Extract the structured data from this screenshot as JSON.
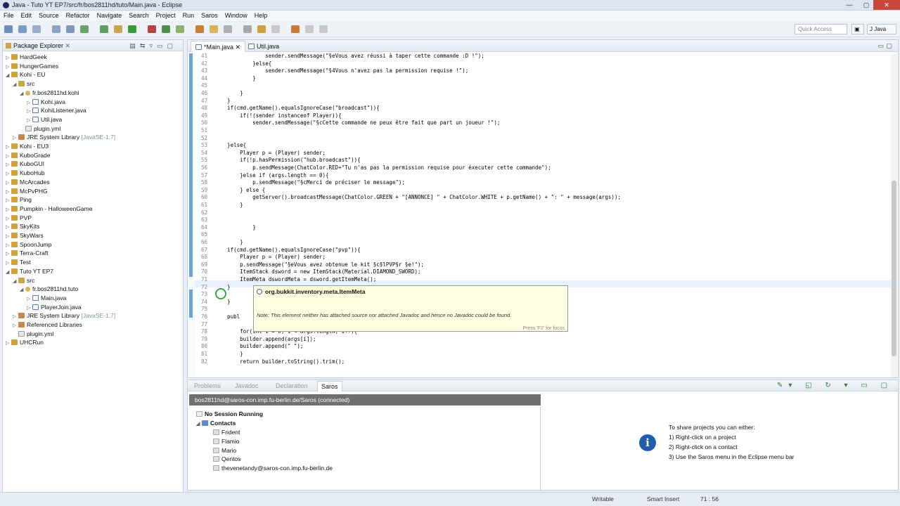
{
  "window": {
    "title": "Java - Tuto YT EP7/src/fr/bos2811hd/tuto/Main.java - Eclipse",
    "controls": [
      "—",
      "▢",
      "✕"
    ]
  },
  "menubar": [
    "File",
    "Edit",
    "Source",
    "Refactor",
    "Navigate",
    "Search",
    "Project",
    "Run",
    "Saros",
    "Window",
    "Help"
  ],
  "toolbar": {
    "quick_access": "Quick Access"
  },
  "package_explorer": {
    "title": "Package Explorer",
    "rows": [
      {
        "label": "HardGeek",
        "kind": "proj",
        "indent": 0,
        "tw": "▷"
      },
      {
        "label": "HungerGames",
        "kind": "proj",
        "indent": 0,
        "tw": "▷"
      },
      {
        "label": "Kohi - EU",
        "kind": "proj",
        "indent": 0,
        "tw": "◢"
      },
      {
        "label": "src",
        "kind": "src",
        "indent": 1,
        "tw": "◢"
      },
      {
        "label": "fr.bos2811hd.kohi",
        "kind": "pkg",
        "indent": 2,
        "tw": "◢"
      },
      {
        "label": "Kohi.java",
        "kind": "java",
        "indent": 3,
        "tw": "▷"
      },
      {
        "label": "KohiListener.java",
        "kind": "java",
        "indent": 3,
        "tw": "▷"
      },
      {
        "label": "Util.java",
        "kind": "java",
        "indent": 3,
        "tw": "▷"
      },
      {
        "label": "plugin.yml",
        "kind": "yml",
        "indent": 2,
        "tw": ""
      },
      {
        "label": "JRE System Library",
        "suffix": "[JavaSE-1.7]",
        "kind": "lib",
        "indent": 1,
        "tw": "▷"
      },
      {
        "label": "Kohi - EU3",
        "kind": "proj",
        "indent": 0,
        "tw": "▷"
      },
      {
        "label": "KuboGrade",
        "kind": "proj",
        "indent": 0,
        "tw": "▷"
      },
      {
        "label": "KuboGUI",
        "kind": "proj",
        "indent": 0,
        "tw": "▷"
      },
      {
        "label": "KuboHub",
        "kind": "proj",
        "indent": 0,
        "tw": "▷"
      },
      {
        "label": "McArcades",
        "kind": "proj",
        "indent": 0,
        "tw": "▷"
      },
      {
        "label": "McPvPHG",
        "kind": "proj",
        "indent": 0,
        "tw": "▷"
      },
      {
        "label": "Ping",
        "kind": "proj",
        "indent": 0,
        "tw": "▷"
      },
      {
        "label": "Pumpkin - HalloweenGame",
        "kind": "proj",
        "indent": 0,
        "tw": "▷"
      },
      {
        "label": "PVP",
        "kind": "proj",
        "indent": 0,
        "tw": "▷"
      },
      {
        "label": "SkyKits",
        "kind": "proj",
        "indent": 0,
        "tw": "▷"
      },
      {
        "label": "SkyWars",
        "kind": "proj",
        "indent": 0,
        "tw": "▷"
      },
      {
        "label": "SpoonJump",
        "kind": "proj",
        "indent": 0,
        "tw": "▷"
      },
      {
        "label": "Terra-Craft",
        "kind": "proj",
        "indent": 0,
        "tw": "▷"
      },
      {
        "label": "Test",
        "kind": "proj",
        "indent": 0,
        "tw": "▷"
      },
      {
        "label": "Tuto YT EP7",
        "kind": "proj",
        "indent": 0,
        "tw": "◢"
      },
      {
        "label": "src",
        "kind": "src",
        "indent": 1,
        "tw": "◢"
      },
      {
        "label": "fr.bos2811hd.tuto",
        "kind": "pkg",
        "indent": 2,
        "tw": "◢"
      },
      {
        "label": "Main.java",
        "kind": "java",
        "indent": 3,
        "tw": "▷"
      },
      {
        "label": "PlayerJoin.java",
        "kind": "java",
        "indent": 3,
        "tw": "▷"
      },
      {
        "label": "JRE System Library",
        "suffix": "[JavaSE-1.7]",
        "kind": "lib",
        "indent": 1,
        "tw": "▷"
      },
      {
        "label": "Referenced Libraries",
        "kind": "lib",
        "indent": 1,
        "tw": "▷"
      },
      {
        "label": "plugin.yml",
        "kind": "yml",
        "indent": 1,
        "tw": ""
      },
      {
        "label": "UHCRun",
        "kind": "proj",
        "indent": 0,
        "tw": "▷"
      }
    ]
  },
  "editor": {
    "tabs": [
      "*Main.java",
      "Util.java"
    ],
    "active_tab": 0,
    "lines": [
      {
        "n": "41",
        "t": "                sender.sendMessage(\"§eVous avez réussi à taper cette commande :D !\");"
      },
      {
        "n": "42",
        "t": "            }else{"
      },
      {
        "n": "43",
        "t": "                sender.sendMessage(\"§4Vous n'avez pas la permission requise !\");"
      },
      {
        "n": "44",
        "t": "            }"
      },
      {
        "n": "45",
        "t": ""
      },
      {
        "n": "46",
        "t": "        }"
      },
      {
        "n": "47",
        "t": "    }"
      },
      {
        "n": "48",
        "t": "    if(cmd.getName().equalsIgnoreCase(\"broadcast\")){"
      },
      {
        "n": "49",
        "t": "        if(!(sender instanceof Player)){"
      },
      {
        "n": "50",
        "t": "            sender.sendMessage(\"§cCette commande ne peux être fait que part un joueur !\");"
      },
      {
        "n": "51",
        "t": ""
      },
      {
        "n": "52",
        "t": ""
      },
      {
        "n": "53",
        "t": "    }else{"
      },
      {
        "n": "54",
        "t": "        Player p = (Player) sender;"
      },
      {
        "n": "55",
        "t": "        if(!p.hasPermission(\"hub.broadcast\")){"
      },
      {
        "n": "56",
        "t": "            p.sendMessage(ChatColor.RED+\"Tu n'as pas la permission requise pour éxecuter cette commande\");"
      },
      {
        "n": "57",
        "t": "        }else if (args.length == 0){"
      },
      {
        "n": "58",
        "t": "            p.sendMessage(\"§cMerci de préciser le message\");"
      },
      {
        "n": "59",
        "t": "        } else {"
      },
      {
        "n": "60",
        "t": "            getServer().broadcastMessage(ChatColor.GREEN + \"[ANNONCE] \" + ChatColor.WHITE + p.getName() + \": \" + message(args));"
      },
      {
        "n": "61",
        "t": "        }"
      },
      {
        "n": "62",
        "t": ""
      },
      {
        "n": "63",
        "t": ""
      },
      {
        "n": "64",
        "t": "            }"
      },
      {
        "n": "65",
        "t": ""
      },
      {
        "n": "66",
        "t": "        }"
      },
      {
        "n": "67",
        "t": "    if(cmd.getName().equalsIgnoreCase(\"pvp\")){"
      },
      {
        "n": "68",
        "t": "        Player p = (Player) sender;"
      },
      {
        "n": "69",
        "t": "        p.sendMessage(\"§eVous avez obtenue le kit §c§lPVP§r §e!\");"
      },
      {
        "n": "70",
        "t": "        ItemStack dsword = new ItemStack(Material.DIAMOND_SWORD);"
      },
      {
        "n": "71",
        "t": "        ItemMeta dswordMeta = dsword.getItemMeta();"
      },
      {
        "n": "72",
        "t": "    }"
      },
      {
        "n": "73",
        "t": ""
      },
      {
        "n": "74",
        "t": "    }"
      },
      {
        "n": "75",
        "t": ""
      },
      {
        "n": "76",
        "t": "    publ"
      },
      {
        "n": "77",
        "t": ""
      },
      {
        "n": "78",
        "t": "        for(int i = 0; i < args.length; i++){"
      },
      {
        "n": "79",
        "t": "        builder.append(args[i]);"
      },
      {
        "n": "80",
        "t": "        builder.append(\" \");"
      },
      {
        "n": "81",
        "t": "        }"
      },
      {
        "n": "82",
        "t": "        return builder.toString().trim();"
      }
    ],
    "tooltip": {
      "title": "org.bukkit.inventory.meta.ItemMeta",
      "note": "Note: This element neither has attached source nor attached Javadoc and hence no Javadoc could be found.",
      "footer": "Press 'F2' for focus"
    }
  },
  "bottom_panel": {
    "tabs": [
      "Problems",
      "Javadoc",
      "Declaration",
      "Saros"
    ],
    "active_tab": 3,
    "saros_header": "bos2811hd@saros-con.imp.fu-berlin.de/Saros (connected)",
    "session": "No Session Running",
    "contacts_label": "Contacts",
    "contacts": [
      "Frident",
      "Flamio",
      "Mario",
      "Qentos",
      "thevenetandy@saros-con.imp.fu-berlin.de"
    ],
    "info_icon": "i",
    "info": {
      "heading": "To share projects you can either:",
      "steps": [
        "1)  Right-click on a project",
        "2)  Right-click on a contact",
        "3)  Use the Saros menu in the Eclipse menu bar"
      ]
    }
  },
  "statusbar": {
    "writable": "Writable",
    "insert_mode": "Smart Insert",
    "position": "71 : 56"
  }
}
